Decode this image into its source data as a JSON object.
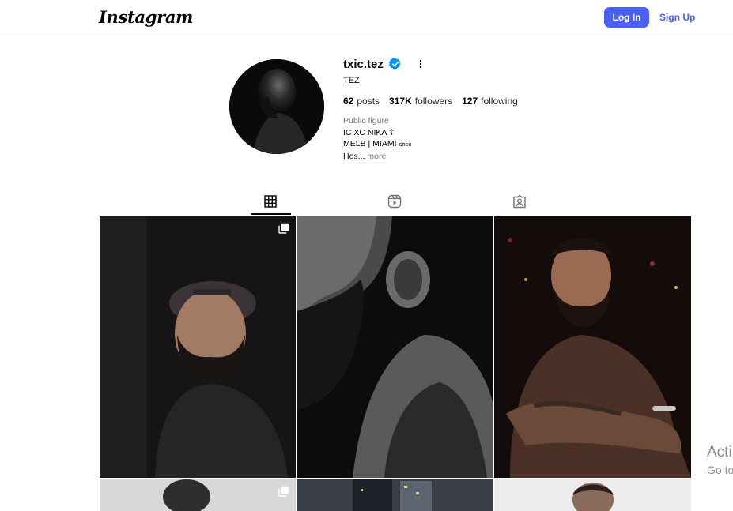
{
  "header": {
    "logo": "Instagram",
    "login_label": "Log In",
    "signup_label": "Sign Up"
  },
  "profile": {
    "username": "txic.tez",
    "verified": true,
    "full_name": "TEZ",
    "stats": {
      "posts_count": "62",
      "posts_label": "posts",
      "followers_count": "317K",
      "followers_label": "followers",
      "following_count": "127",
      "following_label": "following"
    },
    "bio": {
      "category": "Public figure",
      "line1": "IC XC NIKA ☦",
      "line2": "MELB | MIAMI",
      "line2_small": "ɢʀᴄᴜ",
      "line3": "Hos...",
      "more": "more"
    }
  },
  "tabs": [
    {
      "icon": "grid-icon",
      "active": true
    },
    {
      "icon": "reels-icon",
      "active": false
    },
    {
      "icon": "tagged-icon",
      "active": false
    }
  ],
  "posts": [
    {
      "multi": true
    },
    {
      "multi": false
    },
    {
      "multi": false
    },
    {
      "multi": true
    },
    {
      "multi": false
    },
    {
      "multi": false
    }
  ],
  "overlay": {
    "line1": "Acti",
    "line2": "Go to"
  },
  "colors": {
    "accent": "#4a5ff5",
    "verified": "#0095f6",
    "border": "#dbdbdb"
  }
}
